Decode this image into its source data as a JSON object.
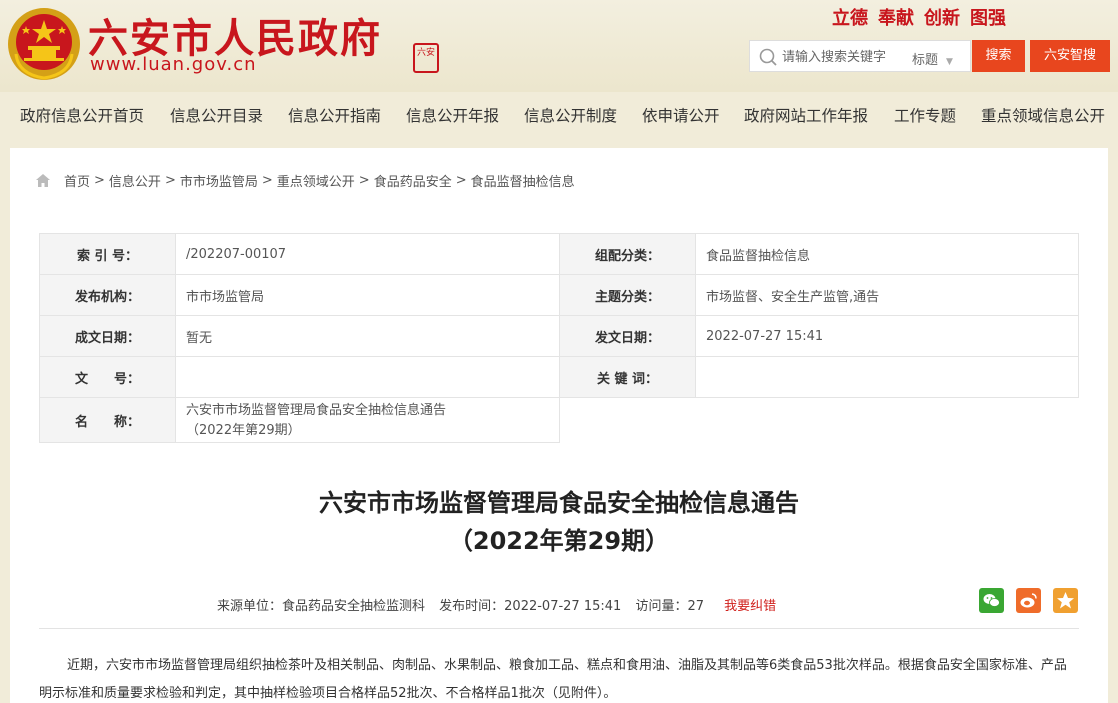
{
  "header": {
    "site_name": "六安市人民政府",
    "site_url": "www.luan.gov.cn",
    "seal_text": "六安",
    "motto": [
      "立德",
      "奉献",
      "创新",
      "图强"
    ],
    "search": {
      "placeholder": "请输入搜索关键字",
      "type": "标题",
      "search_button": "搜索",
      "smart_button": "六安智搜"
    }
  },
  "nav": {
    "items": [
      "政府信息公开首页",
      "信息公开目录",
      "信息公开指南",
      "信息公开年报",
      "信息公开制度",
      "依申请公开",
      "政府网站工作年报",
      "工作专题",
      "重点领域信息公开"
    ]
  },
  "breadcrumb": [
    "首页",
    "信息公开",
    "市市场监管局",
    "重点领域公开",
    "食品药品安全",
    "食品监督抽检信息"
  ],
  "info": {
    "index_no_label": "索 引 号：",
    "index_no": "/202207-00107",
    "category_label": "组配分类：",
    "category": "食品监督抽检信息",
    "publisher_label": "发布机构：",
    "publisher": "市市场监管局",
    "topic_label": "主题分类：",
    "topic": "市场监督、安全生产监管,通告",
    "created_label": "成文日期：",
    "created": "暂无",
    "published_label": "发文日期：",
    "published": "2022-07-27 15:41",
    "doc_no_label": "文　　号：",
    "doc_no": "",
    "keywords_label": "关 键 词：",
    "keywords": "",
    "name_label": "名　　称：",
    "name_line1": "六安市市场监督管理局食品安全抽检信息通告",
    "name_line2": "（2022年第29期）"
  },
  "article": {
    "title_line1": "六安市市场监督管理局食品安全抽检信息通告",
    "title_line2": "（2022年第29期）",
    "source": "来源单位：食品药品安全抽检监测科",
    "time": "发布时间：2022-07-27 15:41",
    "views": "访问量：27",
    "report_error": "我要纠错",
    "body": "近期，六安市市场监督管理局组织抽检茶叶及相关制品、肉制品、水果制品、粮食加工品、糕点和食用油、油脂及其制品等6类食品53批次样品。根据食品安全国家标准、产品明示标准和质量要求检验和判定，其中抽样检验项目合格样品52批次、不合格样品1批次（见附件）。"
  },
  "colors": {
    "brand_red": "#c8161d",
    "button_orange": "#e8461e",
    "wechat_green": "#3aa733",
    "weibo_orange": "#ef6c2a",
    "fav_yellow": "#f0a030"
  }
}
